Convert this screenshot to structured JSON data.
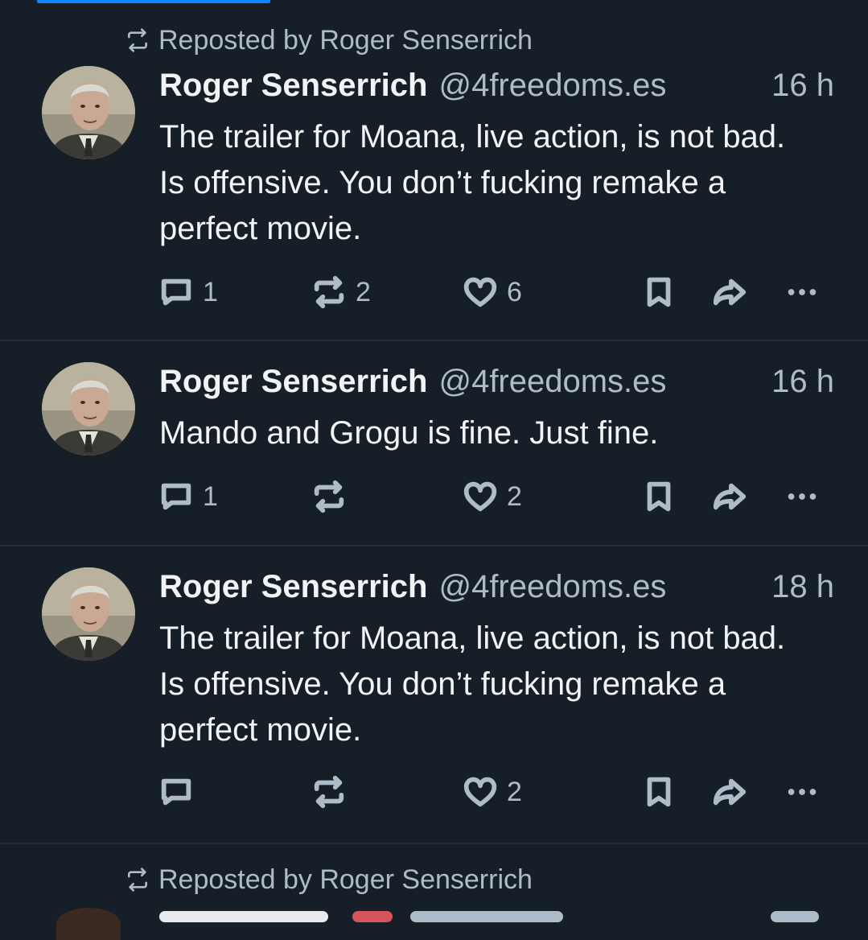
{
  "feed": {
    "posts": [
      {
        "repost_label": "Reposted by Roger Senserrich",
        "author": "Roger Senserrich",
        "handle": "@4freedoms.es",
        "time": "16 h",
        "text": "The trailer for Moana, live action, is not bad. Is offensive. You don’t fucking remake a perfect movie.",
        "replies": "1",
        "reposts": "2",
        "likes": "6"
      },
      {
        "author": "Roger Senserrich",
        "handle": "@4freedoms.es",
        "time": "16 h",
        "text": "Mando and Grogu is fine. Just fine.",
        "replies": "1",
        "reposts": "",
        "likes": "2"
      },
      {
        "author": "Roger Senserrich",
        "handle": "@4freedoms.es",
        "time": "18 h",
        "text": "The trailer for Moana, live action, is not bad. Is offensive. You don’t fucking remake a perfect movie.",
        "replies": "",
        "reposts": "",
        "likes": "2"
      },
      {
        "repost_label": "Reposted by Roger Senserrich"
      }
    ]
  },
  "colors": {
    "background": "#161e27",
    "accent": "#1083fe",
    "muted_text": "#aebbc9",
    "divider": "#232e3a"
  },
  "icons": [
    "repost-icon",
    "reply-icon",
    "like-icon",
    "bookmark-icon",
    "share-icon",
    "more-icon"
  ]
}
